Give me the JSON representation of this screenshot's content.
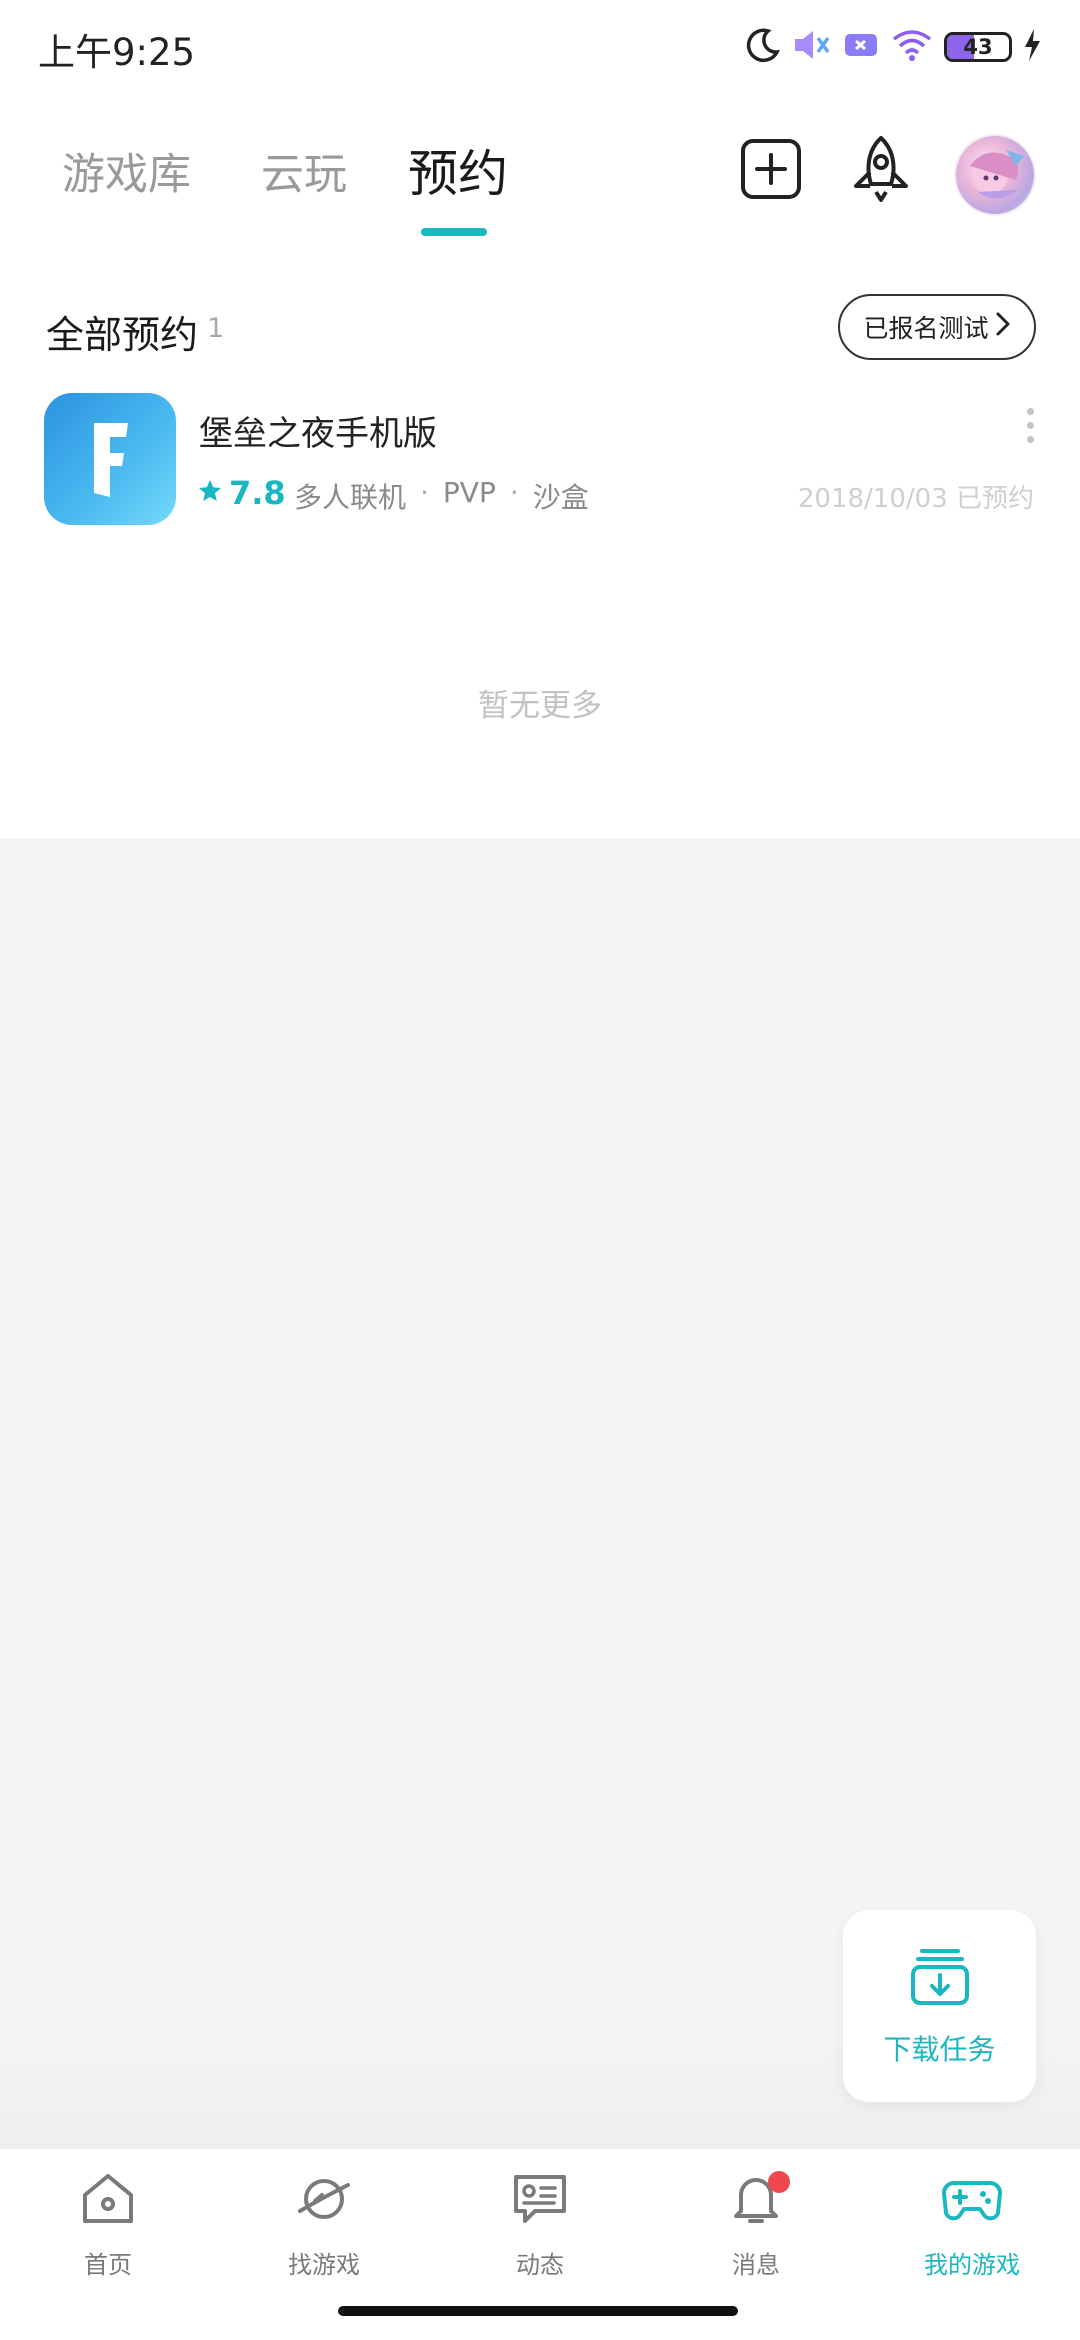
{
  "status_bar": {
    "time": "上午9:25",
    "battery_level": "43",
    "battery_fraction": 0.43,
    "icons": [
      "moon-icon",
      "mute-icon",
      "card-icon",
      "wifi-icon",
      "battery-icon",
      "charging-icon"
    ]
  },
  "header": {
    "tabs": [
      {
        "label": "游戏库",
        "active": false
      },
      {
        "label": "云玩",
        "active": false
      },
      {
        "label": "预约",
        "active": true
      }
    ],
    "actions": [
      "add-icon",
      "rocket-icon",
      "avatar"
    ]
  },
  "section": {
    "title": "全部预约",
    "count": "1",
    "signed_button": "已报名测试"
  },
  "games": [
    {
      "name": "堡垒之夜手机版",
      "icon_letter": "F",
      "rating": "7.8",
      "tags": [
        "多人联机",
        "PVP",
        "沙盒"
      ],
      "tag_separator": "·",
      "date_status": "2018/10/03 已预约"
    }
  ],
  "empty_hint": "暂无更多",
  "download_card": {
    "label": "下载任务"
  },
  "bottom_nav": [
    {
      "label": "首页",
      "icon": "home-icon",
      "active": false
    },
    {
      "label": "找游戏",
      "icon": "planet-icon",
      "active": false
    },
    {
      "label": "动态",
      "icon": "feed-icon",
      "active": false
    },
    {
      "label": "消息",
      "icon": "bell-icon",
      "active": false,
      "badge": true
    },
    {
      "label": "我的游戏",
      "icon": "gamepad-icon",
      "active": true
    }
  ],
  "colors": {
    "accent": "#1ab7c1",
    "badge": "#f0474e",
    "background_gray": "#f4f5f7",
    "battery_fill": "#8f63ea"
  }
}
